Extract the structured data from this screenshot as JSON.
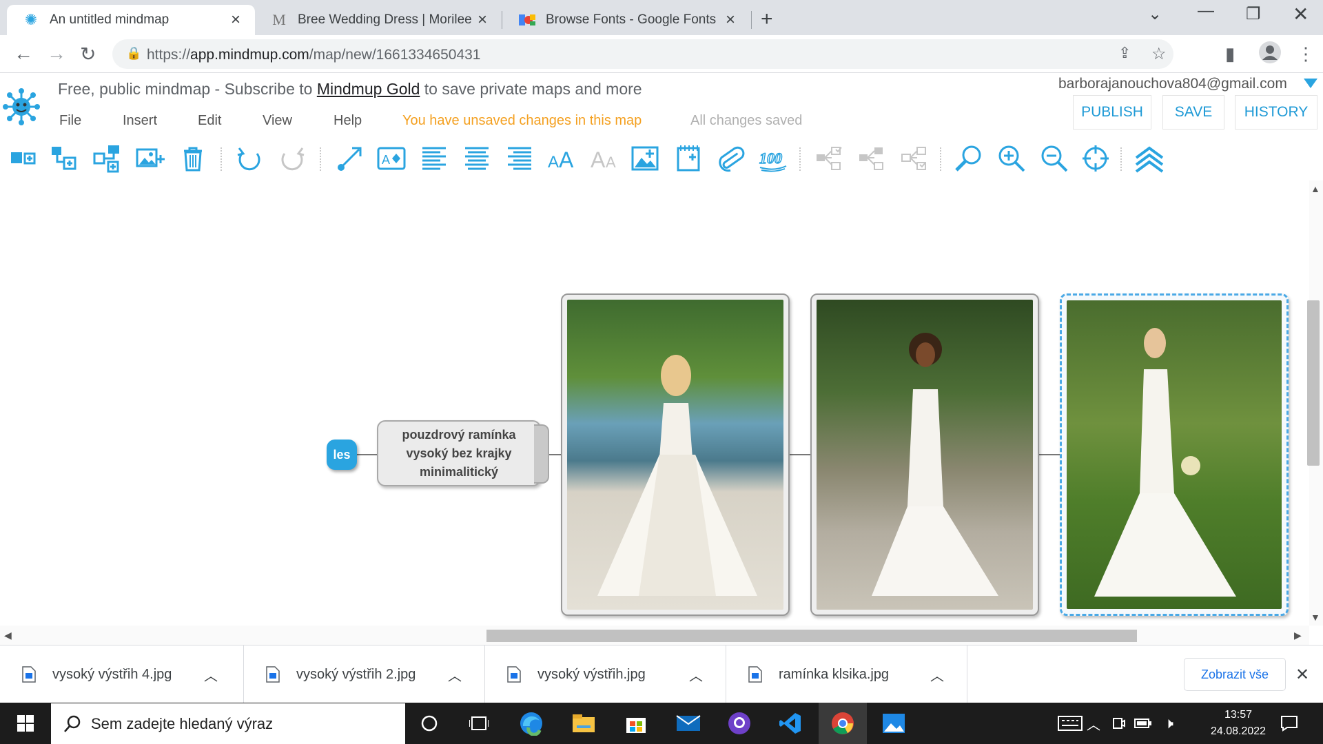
{
  "browser": {
    "tabs": [
      {
        "title": "An untitled mindmap",
        "active": true,
        "icon": "mindmup-icon"
      },
      {
        "title": "Bree Wedding Dress | Morilee",
        "active": false,
        "icon": "morilee-m-icon"
      },
      {
        "title": "Browse Fonts - Google Fonts",
        "active": false,
        "icon": "google-fonts-icon"
      }
    ],
    "url_prefix": "https://",
    "url_host": "app.mindmup.com",
    "url_path": "/map/new/1661334650431"
  },
  "app": {
    "promo_before": "Free, public mindmap - Subscribe to ",
    "promo_link": "Mindmup Gold",
    "promo_after": " to save private maps and more",
    "menu": [
      "File",
      "Insert",
      "Edit",
      "View",
      "Help"
    ],
    "unsaved_status": "You have unsaved changes in this map",
    "saved_status": "All changes saved",
    "account_email": "barborajanouchova804@gmail.com",
    "buttons": {
      "publish": "PUBLISH",
      "save": "SAVE",
      "history": "HISTORY"
    },
    "accent_color": "#2aa4e0",
    "unsaved_color": "#f4a020"
  },
  "mindmap": {
    "root_label": "les",
    "node_text": "pouzdrový ramínka vysoký bez krajky minimalitický",
    "image_nodes": 3,
    "selected_image_index": 2
  },
  "downloads": {
    "items": [
      "vysoký výstřih 4.jpg",
      "vysoký výstřih 2.jpg",
      "vysoký výstřih.jpg",
      "ramínka klsika.jpg"
    ],
    "show_all": "Zobrazit vše"
  },
  "taskbar": {
    "search_placeholder": "Sem zadejte hledaný výraz",
    "time": "13:57",
    "date": "24.08.2022"
  }
}
